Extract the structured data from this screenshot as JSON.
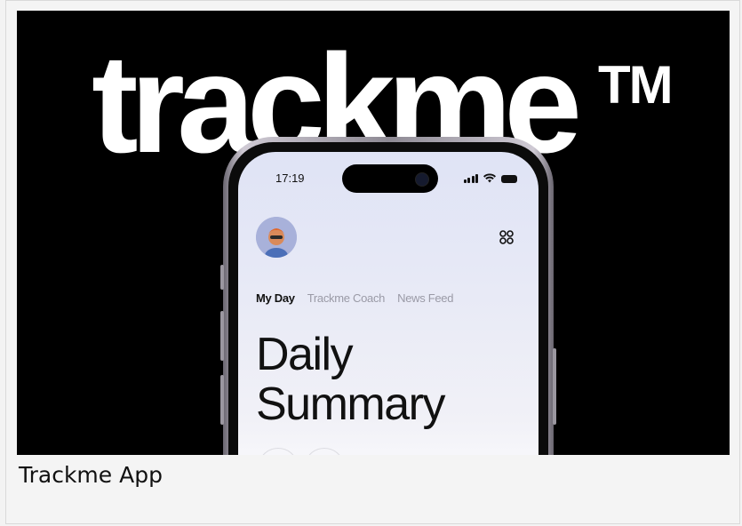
{
  "banner": {
    "brand_text": "trackme",
    "trademark": "TM"
  },
  "phone": {
    "status_time": "17:19",
    "tabs": [
      {
        "label": "My Day",
        "active": true
      },
      {
        "label": "Trackme Coach",
        "active": false
      },
      {
        "label": "News Feed",
        "active": false
      }
    ],
    "headline_line1": "Daily",
    "headline_line2": "Summary",
    "icons": [
      "avatar",
      "grid-icon",
      "signal-icon",
      "wifi-icon",
      "battery-icon"
    ]
  },
  "caption": "Trackme App",
  "colors": {
    "banner_bg": "#000000",
    "page_bg": "#f4f4f4",
    "screen_top": "#dfe3f5",
    "text_dark": "#111111",
    "tab_inactive": "#9a9aa6"
  }
}
